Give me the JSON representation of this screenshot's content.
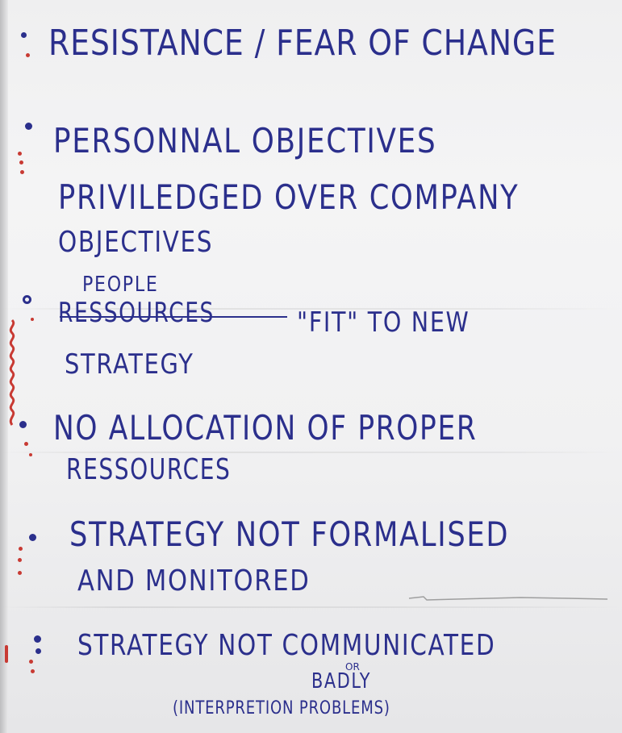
{
  "flipchart": {
    "items": [
      {
        "lines": [
          "RESISTANCE / FEAR OF CHANGE"
        ]
      },
      {
        "lines": [
          "PERSONNAL OBJECTIVES",
          "PRIVILEDGED OVER COMPANY",
          "OBJECTIVES"
        ]
      },
      {
        "insert": "PEOPLE",
        "struck": "RESSOURCES",
        "lines": [
          "\"FIT\" TO NEW",
          "STRATEGY"
        ]
      },
      {
        "lines": [
          "NO ALLOCATION OF PROPER",
          "RESSOURCES"
        ]
      },
      {
        "lines": [
          "STRATEGY NOT FORMALISED",
          "AND MONITORED"
        ]
      },
      {
        "lines": [
          "STRATEGY NOT COMMUNICATED",
          "OR",
          "BADLY",
          "(INTERPRETION PROBLEMS)"
        ]
      }
    ]
  },
  "colors": {
    "ink_blue": "#2b2f8c",
    "ink_red": "#c83a33",
    "paper": "#f1f1f2"
  }
}
